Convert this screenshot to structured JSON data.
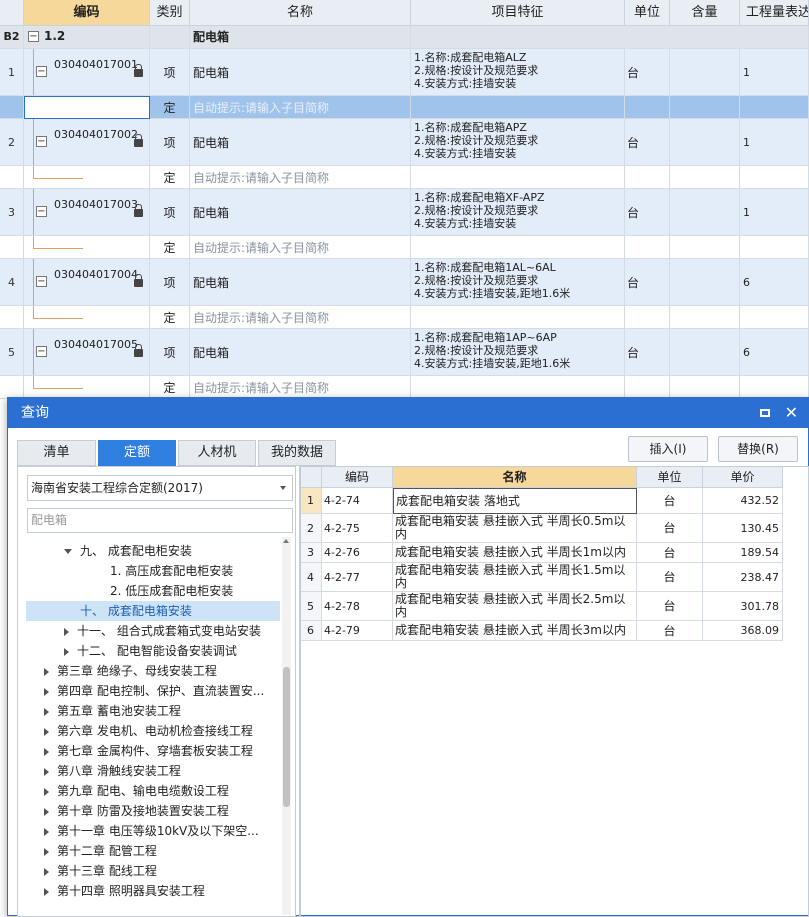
{
  "grid": {
    "headers": [
      "编码",
      "类别",
      "名称",
      "项目特征",
      "单位",
      "含量",
      "工程量表达"
    ],
    "group": {
      "row_label": "B2",
      "code": "1.2",
      "name": "配电箱"
    },
    "rows": [
      {
        "num": "1",
        "code": "030404017001",
        "type": "项",
        "name": "配电箱",
        "feat": "1.名称:成套配电箱ALZ\n2.规格:按设计及规范要求\n4.安装方式:挂墙安装",
        "unit": "台",
        "qty": "1"
      },
      {
        "num": "2",
        "code": "030404017002",
        "type": "项",
        "name": "配电箱",
        "feat": "1.名称:成套配电箱APZ\n2.规格:按设计及规范要求\n4.安装方式:挂墙安装",
        "unit": "台",
        "qty": "1"
      },
      {
        "num": "3",
        "code": "030404017003",
        "type": "项",
        "name": "配电箱",
        "feat": "1.名称:成套配电箱XF-APZ\n2.规格:按设计及规范要求\n4.安装方式:挂墙安装",
        "unit": "台",
        "qty": "1"
      },
      {
        "num": "4",
        "code": "030404017004",
        "type": "项",
        "name": "配电箱",
        "feat": "1.名称:成套配电箱1AL~6AL\n2.规格:按设计及规范要求\n4.安装方式:挂墙安装,距地1.6米",
        "unit": "台",
        "qty": "6"
      },
      {
        "num": "5",
        "code": "030404017005",
        "type": "项",
        "name": "配电箱",
        "feat": "1.名称:成套配电箱1AP~6AP\n2.规格:按设计及规范要求\n4.安装方式:挂墙安装,距地1.6米",
        "unit": "台",
        "qty": "6"
      }
    ],
    "sub_type": "定",
    "sub_hint": "自动提示:请输入子目简称"
  },
  "dialog": {
    "title": "查询",
    "tabs": [
      "清单",
      "定额",
      "人材机",
      "我的数据"
    ],
    "insert_label": "插入(I)",
    "replace_label": "替换(R)",
    "quota_select": "海南省安装工程综合定额(2017)",
    "search_value": "配电箱",
    "tree": [
      "九、 成套配电柜安装",
      "1. 高压成套配电柜安装",
      "2. 低压成套配电柜安装",
      "十、 成套配电箱安装",
      "十一、 组合式成套箱式变电站安装",
      "十二、 配电智能设备安装调试",
      "第三章 绝缘子、母线安装工程",
      "第四章 配电控制、保护、直流装置安...",
      "第五章 蓄电池安装工程",
      "第六章 发电机、电动机检查接线工程",
      "第七章 金属构件、穿墙套板安装工程",
      "第八章 滑触线安装工程",
      "第九章 配电、输电电缆敷设工程",
      "第十章 防雷及接地装置安装工程",
      "第十一章 电压等级10kV及以下架空...",
      "第十二章 配管工程",
      "第十三章 配线工程",
      "第十四章 照明器具安装工程"
    ],
    "result_headers": [
      "编码",
      "名称",
      "单位",
      "单价"
    ],
    "results": [
      {
        "no": "1",
        "code": "4-2-74",
        "name": "成套配电箱安装 落地式",
        "unit": "台",
        "price": "432.52"
      },
      {
        "no": "2",
        "code": "4-2-75",
        "name": "成套配电箱安装 悬挂嵌入式 半周长0.5m以内",
        "unit": "台",
        "price": "130.45"
      },
      {
        "no": "3",
        "code": "4-2-76",
        "name": "成套配电箱安装 悬挂嵌入式 半周长1m以内",
        "unit": "台",
        "price": "189.54"
      },
      {
        "no": "4",
        "code": "4-2-77",
        "name": "成套配电箱安装 悬挂嵌入式 半周长1.5m以内",
        "unit": "台",
        "price": "238.47"
      },
      {
        "no": "5",
        "code": "4-2-78",
        "name": "成套配电箱安装 悬挂嵌入式 半周长2.5m以内",
        "unit": "台",
        "price": "301.78"
      },
      {
        "no": "6",
        "code": "4-2-79",
        "name": "成套配电箱安装 悬挂嵌入式 半周长3m以内",
        "unit": "台",
        "price": "368.09"
      }
    ]
  }
}
